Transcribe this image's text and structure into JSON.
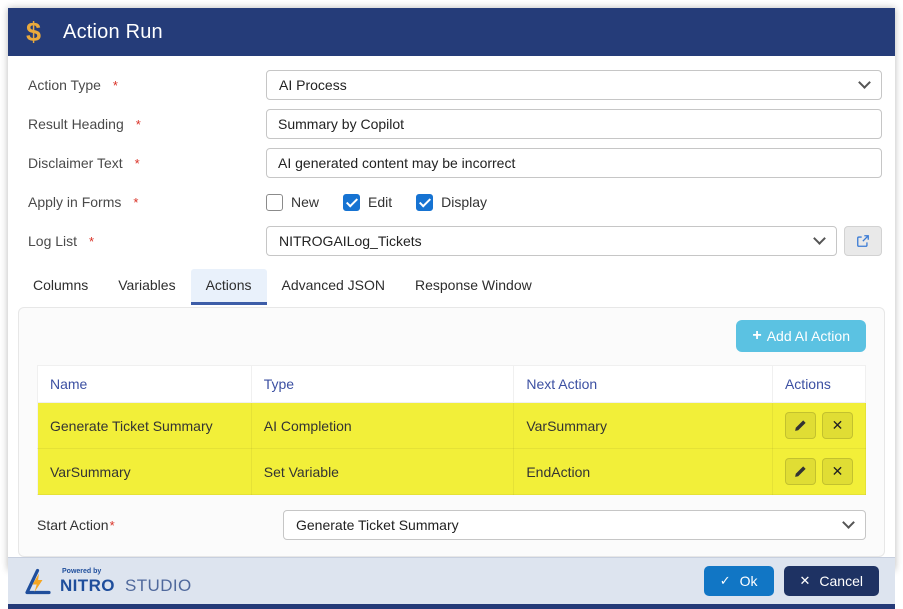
{
  "header": {
    "icon": "$",
    "title": "Action Run"
  },
  "required_marker": "*",
  "form": {
    "action_type": {
      "label": "Action Type",
      "value": "AI Process"
    },
    "result_heading": {
      "label": "Result Heading",
      "value": "Summary by Copilot"
    },
    "disclaimer_text": {
      "label": "Disclaimer Text",
      "value": "AI generated content may be incorrect"
    },
    "apply_in_forms": {
      "label": "Apply in Forms",
      "options": [
        {
          "label": "New",
          "checked": false
        },
        {
          "label": "Edit",
          "checked": true
        },
        {
          "label": "Display",
          "checked": true
        }
      ]
    },
    "log_list": {
      "label": "Log List",
      "value": "NITROGAILog_Tickets"
    }
  },
  "tabs": [
    {
      "label": "Columns",
      "active": false
    },
    {
      "label": "Variables",
      "active": false
    },
    {
      "label": "Actions",
      "active": true
    },
    {
      "label": "Advanced JSON",
      "active": false
    },
    {
      "label": "Response Window",
      "active": false
    }
  ],
  "actions_tab": {
    "add_button": {
      "icon": "+",
      "label": "Add AI Action"
    },
    "table": {
      "columns": [
        "Name",
        "Type",
        "Next Action",
        "Actions"
      ],
      "rows": [
        {
          "name": "Generate Ticket Summary",
          "type": "AI Completion",
          "next_action": "VarSummary",
          "highlighted": true
        },
        {
          "name": "VarSummary",
          "type": "Set Variable",
          "next_action": "EndAction",
          "highlighted": true
        }
      ]
    },
    "start_action": {
      "label": "Start Action",
      "value": "Generate Ticket Summary"
    }
  },
  "footer": {
    "logo": {
      "powered_by": "Powered by",
      "brand": "NITRO",
      "brand_suffix": "STUDIO"
    },
    "ok_button": {
      "icon": "✓",
      "label": "Ok"
    },
    "cancel_button": {
      "icon": "✕",
      "label": "Cancel"
    }
  },
  "colors": {
    "header_bg": "#253c79",
    "accent_gold": "#e9a93c",
    "highlight_yellow": "#f2ef39",
    "checkbox_blue": "#1673d2",
    "add_button_blue": "#5bc2e2",
    "ok_blue": "#1176c5",
    "cancel_navy": "#1e3263",
    "table_header_text": "#3c50a2"
  }
}
